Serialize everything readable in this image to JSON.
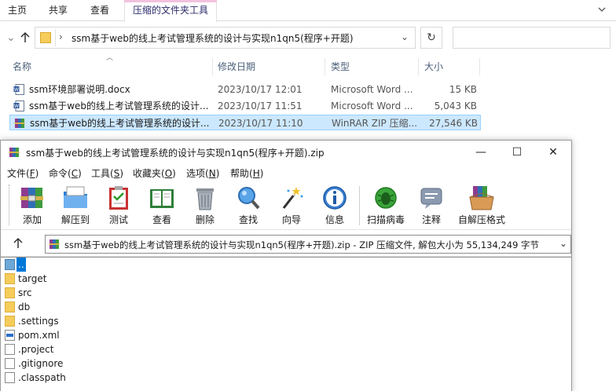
{
  "explorer": {
    "ribbon_tabs": [
      "主页",
      "共享",
      "查看",
      "压缩的文件夹工具"
    ],
    "address_path": "ssm基于web的线上考试管理系统的设计与实现n1qn5(程序+开题)",
    "columns": {
      "name": "名称",
      "date": "修改日期",
      "type": "类型",
      "size": "大小"
    },
    "files": [
      {
        "name": "ssm环境部署说明.docx",
        "date": "2023/10/17 12:01",
        "type": "Microsoft Word ...",
        "size": "15 KB",
        "icon": "word-doc-icon"
      },
      {
        "name": "ssm基于web的线上考试管理系统的设计...",
        "date": "2023/10/17 11:51",
        "type": "Microsoft Word ...",
        "size": "5,043 KB",
        "icon": "word-doc-icon"
      },
      {
        "name": "ssm基于web的线上考试管理系统的设计...",
        "date": "2023/10/17 11:10",
        "type": "WinRAR ZIP 压缩...",
        "size": "27,546 KB",
        "icon": "winrar-icon",
        "selected": true
      }
    ]
  },
  "winrar": {
    "title": "ssm基于web的线上考试管理系统的设计与实现n1qn5(程序+开题).zip",
    "menus": [
      {
        "label": "文件",
        "key": "F"
      },
      {
        "label": "命令",
        "key": "C"
      },
      {
        "label": "工具",
        "key": "S"
      },
      {
        "label": "收藏夹",
        "key": "O"
      },
      {
        "label": "选项",
        "key": "N"
      },
      {
        "label": "帮助",
        "key": "H"
      }
    ],
    "toolbar": [
      "添加",
      "解压到",
      "测试",
      "查看",
      "删除",
      "查找",
      "向导",
      "信息",
      "扫描病毒",
      "注释",
      "自解压格式"
    ],
    "address": "ssm基于web的线上考试管理系统的设计与实现n1qn5(程序+开题).zip - ZIP 压缩文件, 解包大小为 55,134,249 字节",
    "items": [
      {
        "name": "..",
        "kind": "up"
      },
      {
        "name": "target",
        "kind": "folder"
      },
      {
        "name": "src",
        "kind": "folder"
      },
      {
        "name": "db",
        "kind": "folder"
      },
      {
        "name": ".settings",
        "kind": "folder"
      },
      {
        "name": "pom.xml",
        "kind": "xml"
      },
      {
        "name": ".project",
        "kind": "file"
      },
      {
        "name": ".gitignore",
        "kind": "file"
      },
      {
        "name": ".classpath",
        "kind": "file"
      }
    ]
  }
}
